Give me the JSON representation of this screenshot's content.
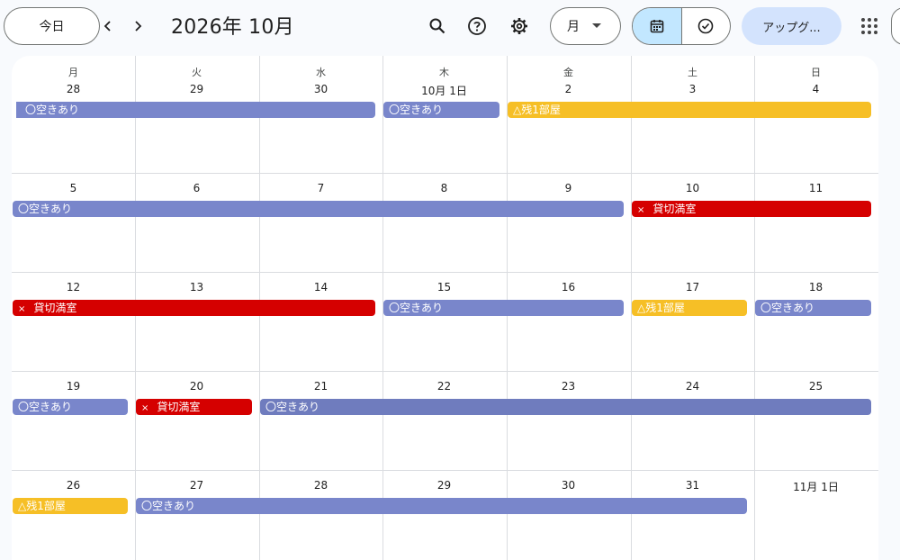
{
  "header": {
    "today_label": "今日",
    "title": "2026年 10月",
    "view_select_label": "月",
    "upgrade_label": "アップグ..."
  },
  "weekdays": [
    "月",
    "火",
    "水",
    "木",
    "金",
    "土",
    "日"
  ],
  "weeks": [
    [
      "28",
      "29",
      "30",
      "10月 1日",
      "2",
      "3",
      "4"
    ],
    [
      "5",
      "6",
      "7",
      "8",
      "9",
      "10",
      "11"
    ],
    [
      "12",
      "13",
      "14",
      "15",
      "16",
      "17",
      "18"
    ],
    [
      "19",
      "20",
      "21",
      "22",
      "23",
      "24",
      "25"
    ],
    [
      "26",
      "27",
      "28",
      "29",
      "30",
      "31",
      "11月 1日"
    ]
  ],
  "events": [
    {
      "week": 0,
      "start": 0,
      "span": 3,
      "label": "〇空きあり",
      "color": "blue",
      "continues_left": true
    },
    {
      "week": 0,
      "start": 3,
      "span": 1,
      "label": "〇空きあり",
      "color": "blue"
    },
    {
      "week": 0,
      "start": 4,
      "span": 3,
      "label": "△残1部屋",
      "color": "yellow"
    },
    {
      "week": 1,
      "start": 0,
      "span": 5,
      "label": "〇空きあり",
      "color": "blue"
    },
    {
      "week": 1,
      "start": 5,
      "span": 2,
      "label": "貸切満室",
      "color": "red",
      "mark": "×"
    },
    {
      "week": 2,
      "start": 0,
      "span": 3,
      "label": "貸切満室",
      "color": "red",
      "mark": "×"
    },
    {
      "week": 2,
      "start": 3,
      "span": 2,
      "label": "〇空きあり",
      "color": "blue"
    },
    {
      "week": 2,
      "start": 5,
      "span": 1,
      "label": "△残1部屋",
      "color": "yellow"
    },
    {
      "week": 2,
      "start": 6,
      "span": 1,
      "label": "〇空きあり",
      "color": "blue"
    },
    {
      "week": 3,
      "start": 0,
      "span": 1,
      "label": "〇空きあり",
      "color": "blue"
    },
    {
      "week": 3,
      "start": 1,
      "span": 1,
      "label": "貸切満室",
      "color": "red",
      "mark": "×"
    },
    {
      "week": 3,
      "start": 2,
      "span": 5,
      "label": "〇空きあり",
      "color": "blue2"
    },
    {
      "week": 4,
      "start": 0,
      "span": 1,
      "label": "△残1部屋",
      "color": "yellow"
    },
    {
      "week": 4,
      "start": 1,
      "span": 5,
      "label": "〇空きあり",
      "color": "blue"
    }
  ],
  "colors": {
    "blue": "#7986cb",
    "blue2": "#6f7cbe",
    "yellow": "#f6bf26",
    "red": "#d50000",
    "selected_view": "#c2e7ff"
  },
  "icons": [
    "chevron-left-icon",
    "chevron-right-icon",
    "search-icon",
    "help-icon",
    "settings-icon",
    "calendar-icon",
    "tasks-icon",
    "apps-grid-icon"
  ]
}
